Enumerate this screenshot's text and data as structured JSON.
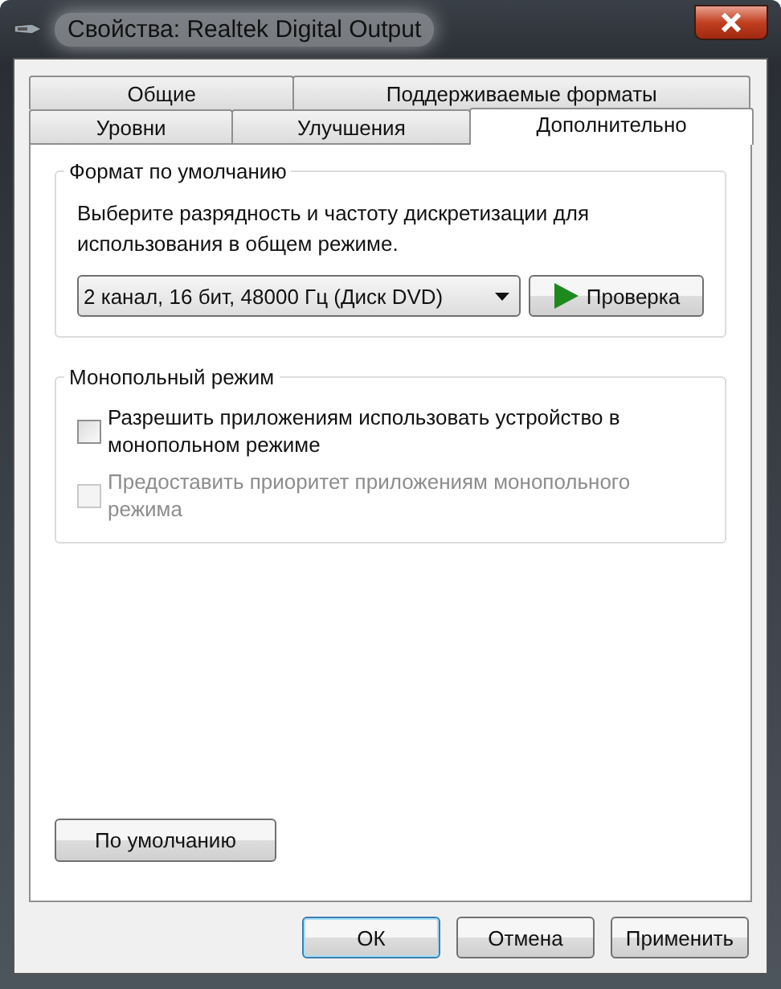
{
  "window": {
    "title": "Свойства: Realtek Digital Output"
  },
  "tab_rows": [
    [
      {
        "label": "Общие",
        "selected": false
      },
      {
        "label": "Поддерживаемые форматы",
        "selected": false
      }
    ],
    [
      {
        "label": "Уровни",
        "selected": false
      },
      {
        "label": "Улучшения",
        "selected": false
      },
      {
        "label": "Дополнительно",
        "selected": true
      }
    ]
  ],
  "default_format": {
    "title": "Формат по умолчанию",
    "description": "Выберите разрядность и частоту дискретизации для использования в общем режиме.",
    "format_value": "2 канал, 16 бит, 48000 Гц (Диск DVD)",
    "test_button": "Проверка"
  },
  "exclusive_mode": {
    "title": "Монопольный режим",
    "options": [
      {
        "label": "Разрешить приложениям использовать устройство в монопольном режиме",
        "checked": false,
        "disabled": false
      },
      {
        "label": "Предоставить приоритет приложениям монопольного режима",
        "checked": false,
        "disabled": true
      }
    ]
  },
  "restore_button": "По умолчанию",
  "buttons": [
    {
      "label": "ОК",
      "default": true
    },
    {
      "label": "Отмена",
      "default": false
    },
    {
      "label": "Применить",
      "default": false
    }
  ]
}
